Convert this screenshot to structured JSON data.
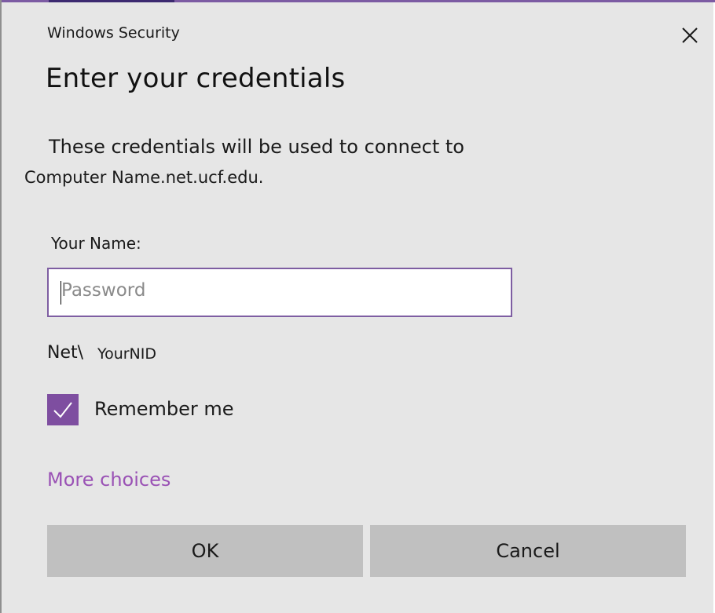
{
  "window": {
    "title": "Windows Security",
    "close_icon": "close-icon"
  },
  "dialog": {
    "heading": "Enter your credentials",
    "description_line1": "These credentials will be used to connect to",
    "description_line2": "Computer Name.net.ucf.edu."
  },
  "form": {
    "name_label": "Your Name:",
    "password_placeholder": "Password",
    "password_value": "",
    "domain_prefix": "Net\\",
    "domain_user": "YourNID",
    "remember_label": "Remember me",
    "remember_checked": true,
    "more_choices_label": "More choices"
  },
  "buttons": {
    "ok_label": "OK",
    "cancel_label": "Cancel"
  },
  "colors": {
    "accent": "#7e4ea0",
    "link": "#9a52b5",
    "background": "#e6e6e6",
    "button": "#c0c0c0"
  }
}
